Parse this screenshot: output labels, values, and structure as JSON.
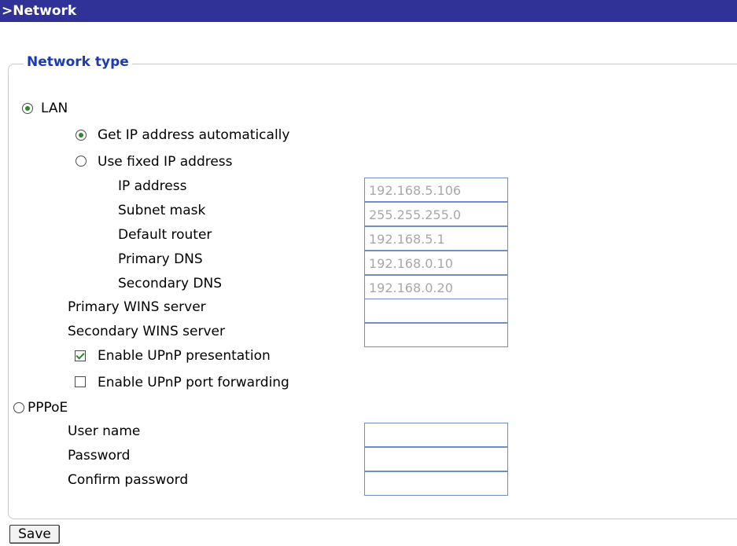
{
  "header": {
    "title": ">Network"
  },
  "network_type": {
    "legend": "Network type",
    "lan": {
      "label": "LAN",
      "selected": true
    },
    "ip_mode": {
      "auto_label": "Get IP address automatically",
      "fixed_label": "Use fixed IP address",
      "selected": "auto"
    },
    "fields": {
      "ip_address": {
        "label": "IP address",
        "value": "192.168.5.106"
      },
      "subnet_mask": {
        "label": "Subnet mask",
        "value": "255.255.255.0"
      },
      "default_router": {
        "label": "Default router",
        "value": "192.168.5.1"
      },
      "primary_dns": {
        "label": "Primary DNS",
        "value": "192.168.0.10"
      },
      "secondary_dns": {
        "label": "Secondary DNS",
        "value": "192.168.0.20"
      },
      "primary_wins": {
        "label": "Primary WINS server",
        "value": ""
      },
      "secondary_wins": {
        "label": "Secondary WINS server",
        "value": ""
      }
    },
    "upnp_presentation": {
      "label": "Enable UPnP presentation",
      "checked": true
    },
    "upnp_port_forwarding": {
      "label": "Enable UPnP port forwarding",
      "checked": false
    },
    "pppoe": {
      "label": "PPPoE",
      "selected": false,
      "user_name": {
        "label": "User name",
        "value": ""
      },
      "password": {
        "label": "Password",
        "value": ""
      },
      "confirm_password": {
        "label": "Confirm password",
        "value": ""
      }
    }
  },
  "actions": {
    "save_label": "Save"
  }
}
